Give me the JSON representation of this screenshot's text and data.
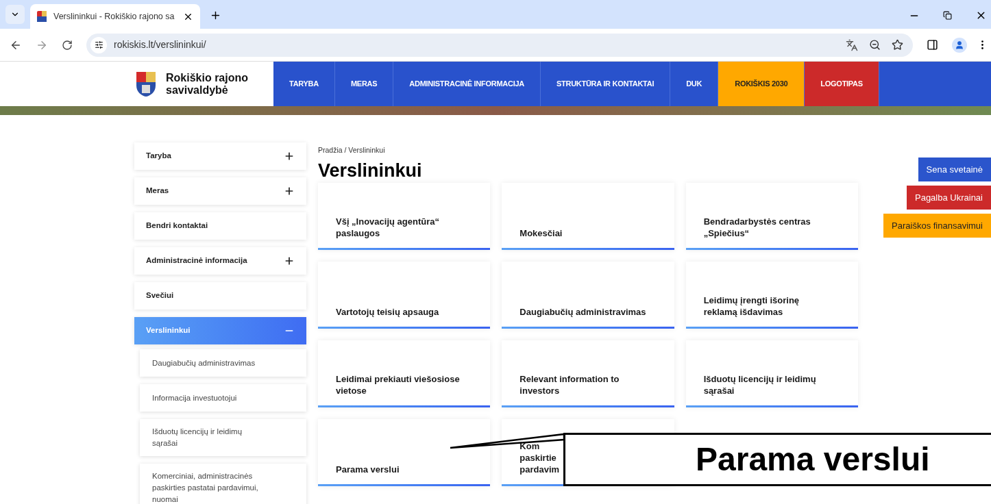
{
  "browser": {
    "tab_title": "Verslininkui - Rokiškio rajono sa",
    "url": "rokiskis.lt/verslininkui/"
  },
  "site": {
    "name": "Rokiškio rajono savivaldybė",
    "nav": [
      {
        "label": "TARYBA",
        "color": "#2952cc"
      },
      {
        "label": "MERAS",
        "color": "#2952cc"
      },
      {
        "label": "ADMINISTRACINĖ INFORMACIJA",
        "color": "#2952cc"
      },
      {
        "label": "STRUKTŪRA IR KONTAKTAI",
        "color": "#2952cc"
      },
      {
        "label": "DUK",
        "color": "#2952cc"
      },
      {
        "label": "ROKIŠKIS 2030",
        "color": "#ffa800"
      },
      {
        "label": "LOGOTIPAS",
        "color": "#cc2a2a"
      }
    ]
  },
  "sidebar": {
    "items": [
      {
        "label": "Taryba",
        "kind": "group",
        "expanded": false,
        "selected": false
      },
      {
        "label": "Meras",
        "kind": "group",
        "expanded": false,
        "selected": false
      },
      {
        "label": "Bendri kontaktai",
        "kind": "link",
        "selected": false
      },
      {
        "label": "Administracinė informacija",
        "kind": "group",
        "expanded": false,
        "selected": false
      },
      {
        "label": "Svečiui",
        "kind": "link",
        "selected": false
      },
      {
        "label": "Verslininkui",
        "kind": "group",
        "expanded": true,
        "selected": true,
        "children": [
          {
            "label": "Daugiabučių administravimas"
          },
          {
            "label": "Informacija investuotojui"
          },
          {
            "label": "Išduotų licencijų ir leidimų sąrašai"
          },
          {
            "label": "Komerciniai, administracinės paskirties pastatai pardavimui, nuomai"
          }
        ]
      }
    ]
  },
  "breadcrumb": "Pradžia / Verslininkui",
  "title": "Verslininkui",
  "cards": [
    {
      "lines": [
        "Všį „Inovacijų agentūra“",
        "paslaugos"
      ]
    },
    {
      "lines": [
        "Mokesčiai"
      ]
    },
    {
      "lines": [
        "Bendradarbystės centras",
        "„Spiečius“"
      ]
    },
    {
      "lines": [
        "Vartotojų teisių apsauga"
      ]
    },
    {
      "lines": [
        "Daugiabučių administravimas"
      ]
    },
    {
      "lines": [
        "Leidimų įrengti išorinę",
        "reklamą išdavimas"
      ]
    },
    {
      "lines": [
        "Leidimai prekiauti viešosiose",
        "vietose"
      ]
    },
    {
      "lines": [
        "Relevant information to",
        "investors"
      ]
    },
    {
      "lines": [
        "Išduotų licencijų ir leidimų",
        "sąrašai"
      ]
    },
    {
      "lines": [
        "Parama verslui"
      ]
    },
    {
      "lines": [
        "Kom",
        "paskirtie",
        "pardavim"
      ]
    }
  ],
  "side_buttons": [
    {
      "label": "Sena svetainė",
      "color": "#2b55cc"
    },
    {
      "label": "Pagalba Ukrainai",
      "color": "#cc2a2a"
    },
    {
      "label": "Paraiškos finansavimui",
      "color": "#ffa800"
    }
  ],
  "callout": {
    "text": "Parama verslui"
  }
}
